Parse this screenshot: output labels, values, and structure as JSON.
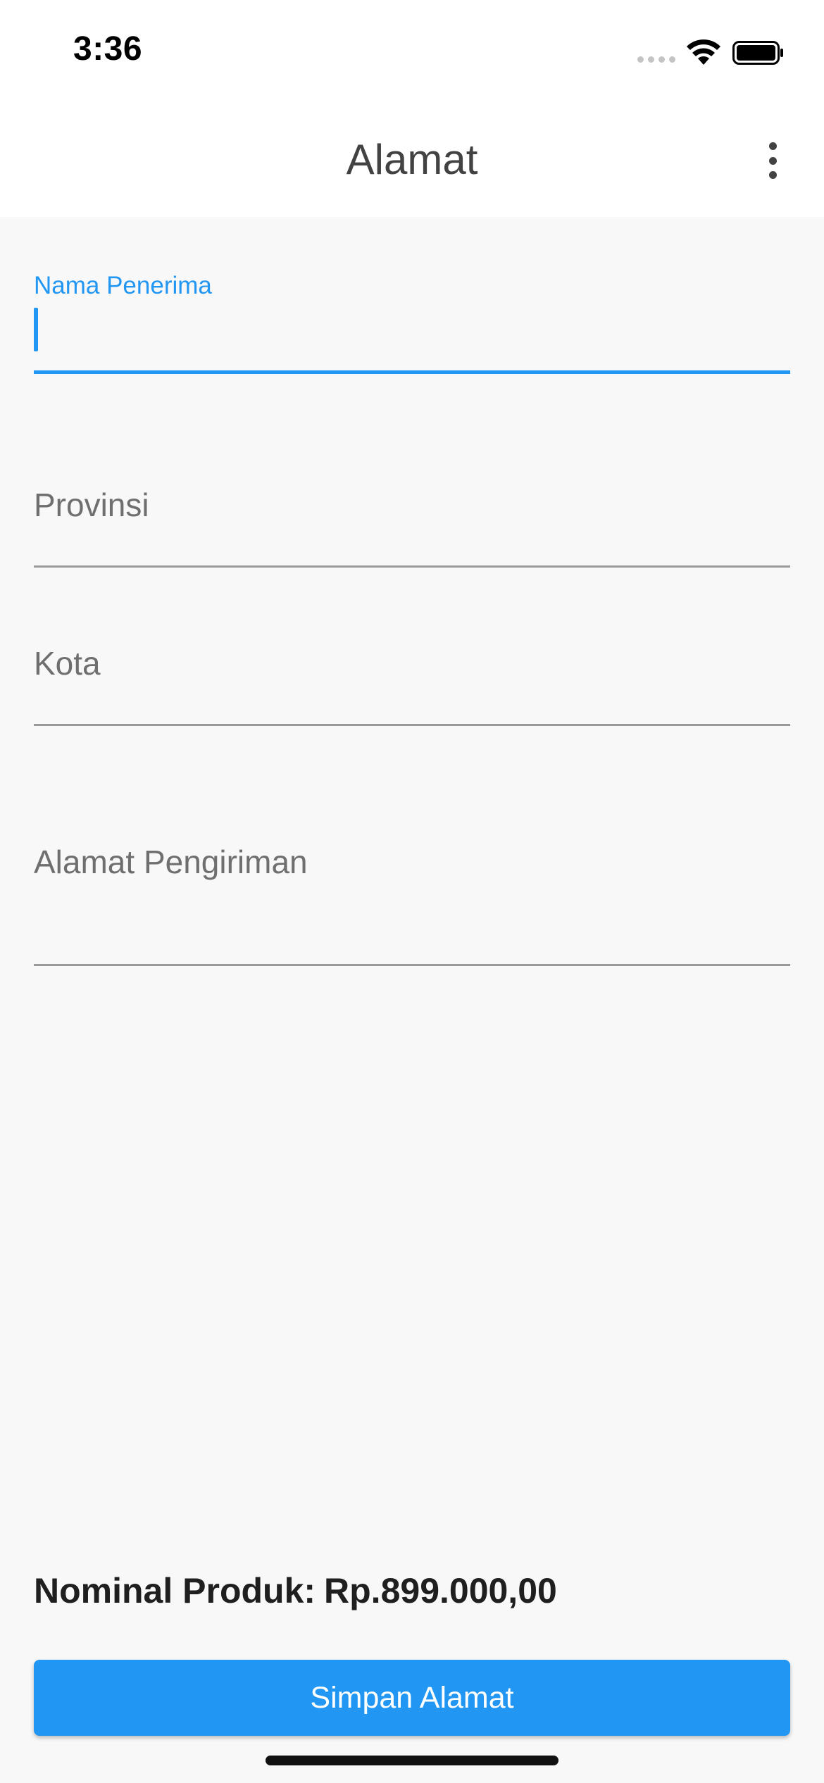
{
  "status_bar": {
    "time": "3:36"
  },
  "app_bar": {
    "title": "Alamat",
    "menu_icon": "more-vertical-icon"
  },
  "form": {
    "recipient_name": {
      "label": "Nama Penerima",
      "value": ""
    },
    "province": {
      "label": "Provinsi",
      "value": ""
    },
    "city": {
      "label": "Kota",
      "value": ""
    },
    "shipping_address": {
      "label": "Alamat Pengiriman",
      "value": ""
    }
  },
  "summary": {
    "nominal_label": "Nominal Produk:",
    "nominal_value": "Rp.899.000,00"
  },
  "actions": {
    "save_label": "Simpan Alamat"
  },
  "colors": {
    "accent": "#2196f3",
    "background": "#f8f8f8",
    "app_bar": "#ffffff"
  }
}
